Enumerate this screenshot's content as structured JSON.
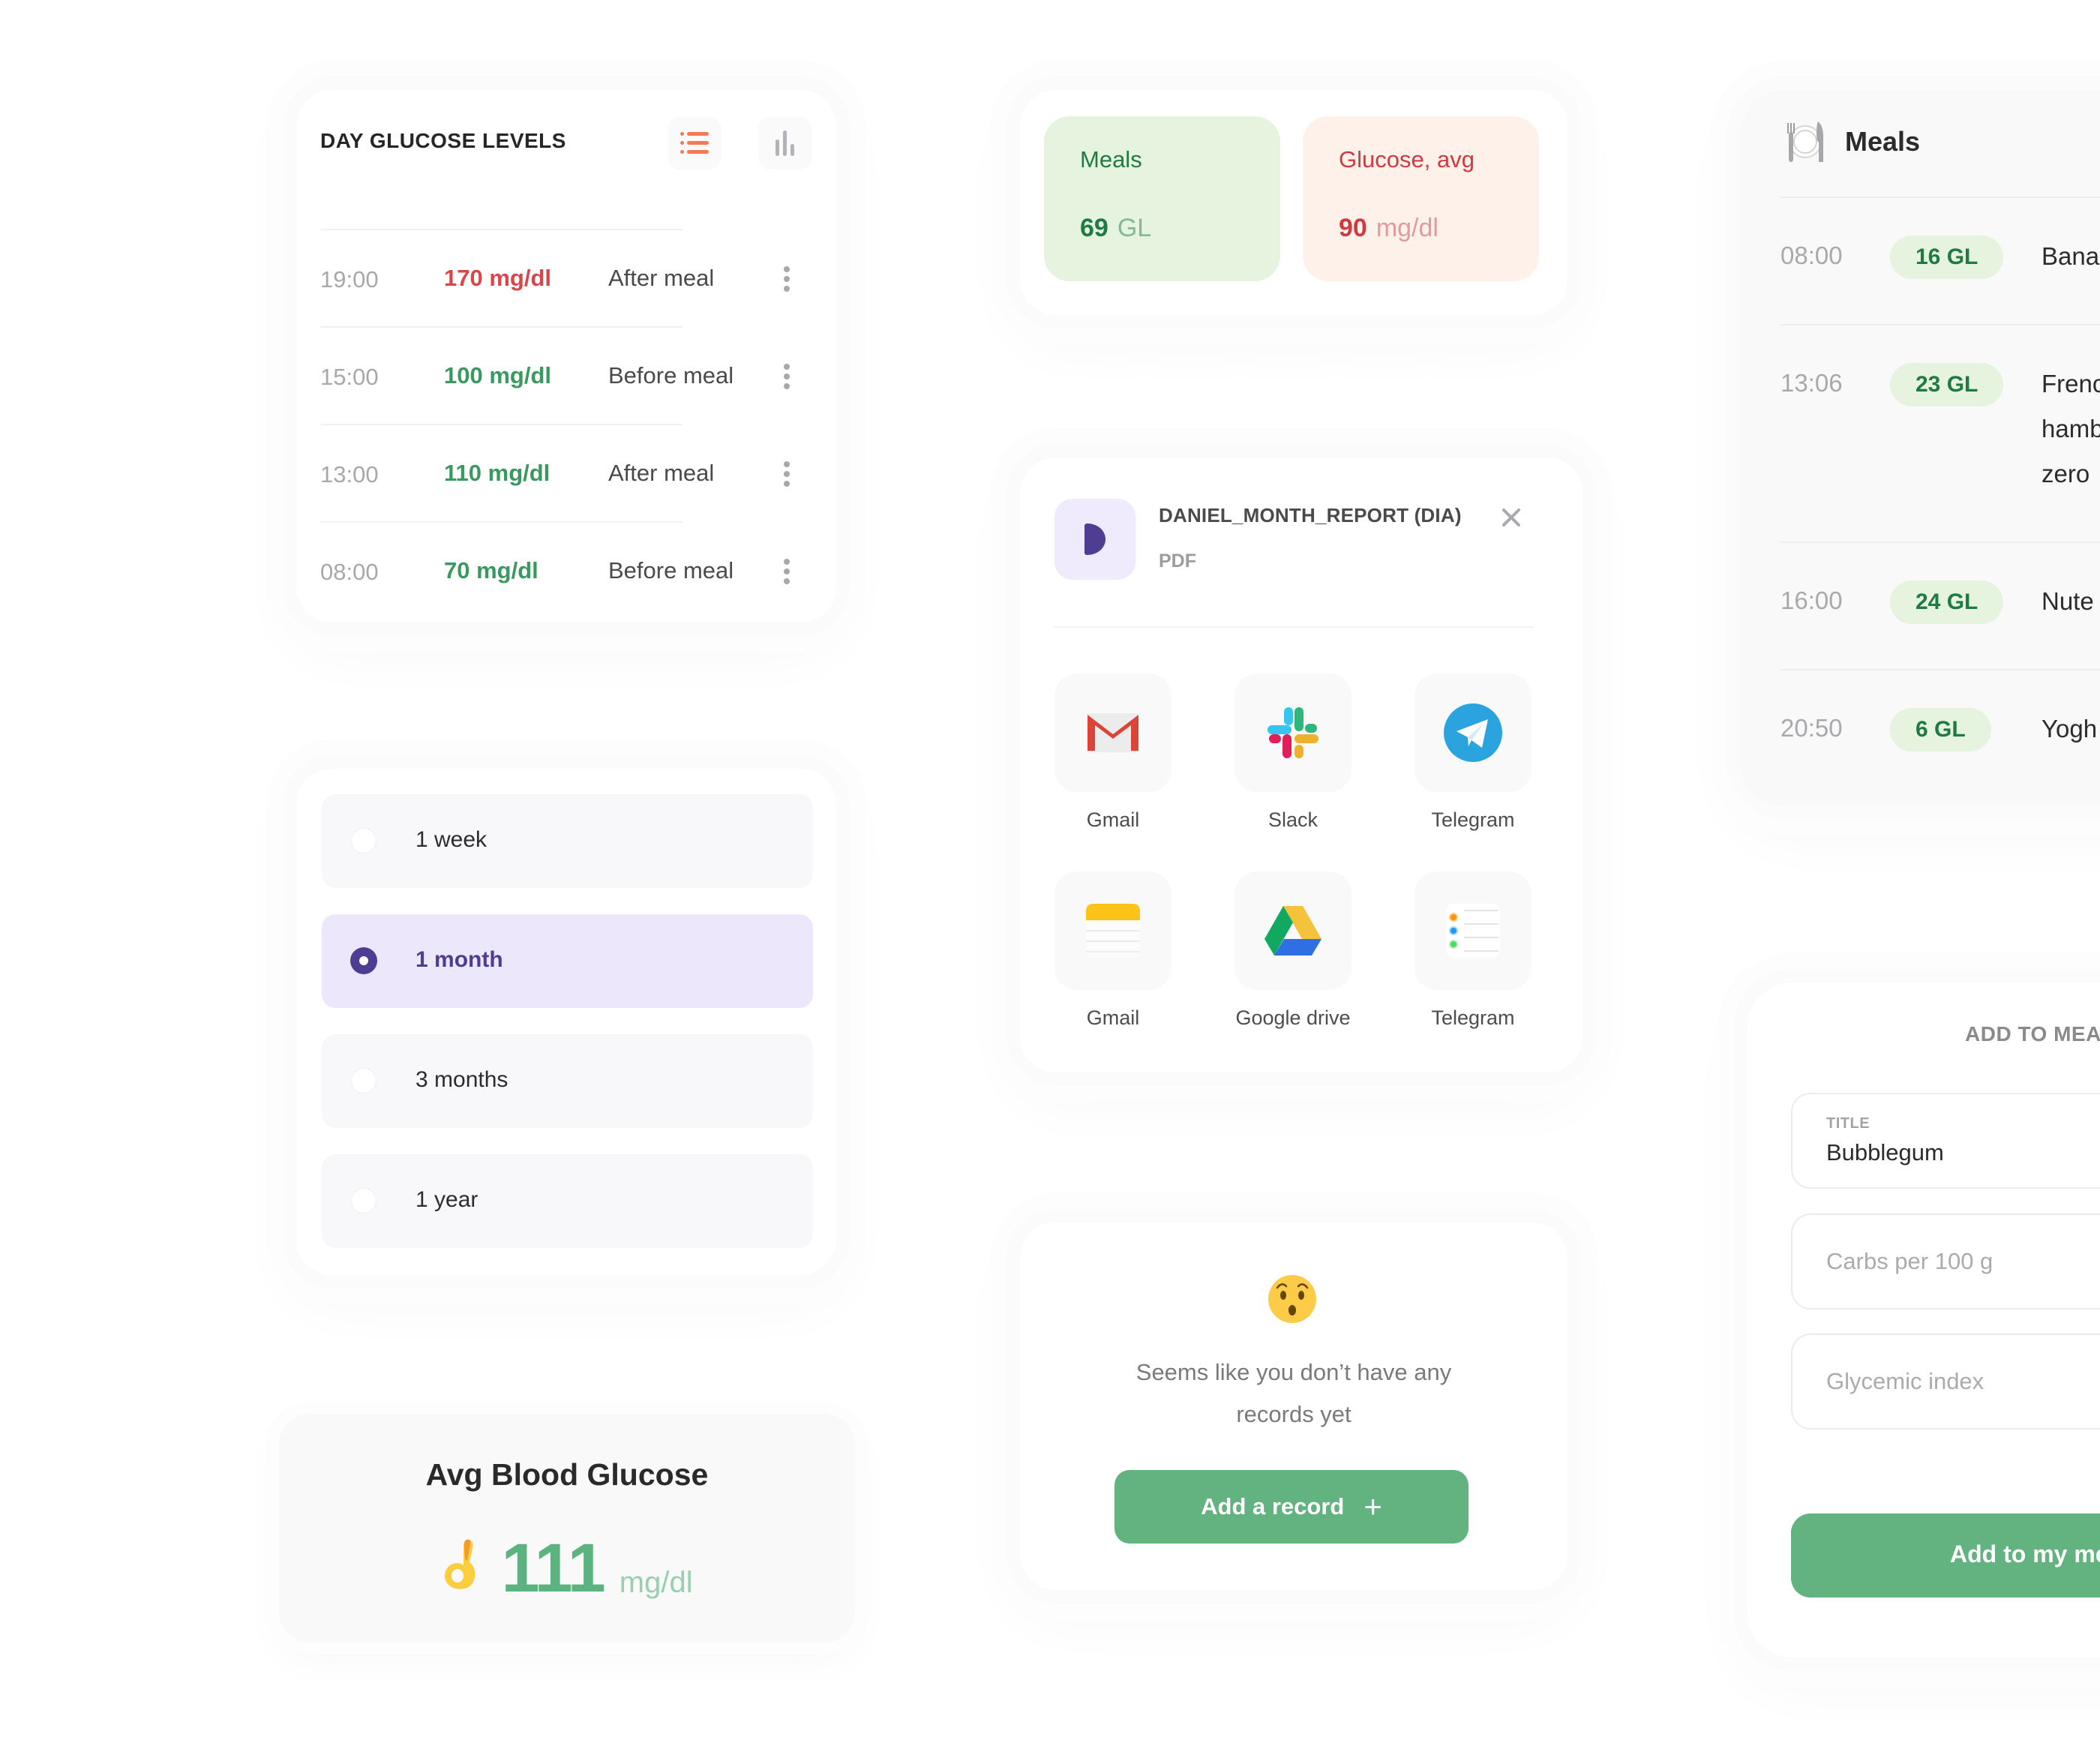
{
  "colors": {
    "accent_purple": "#4e3d92",
    "accent_green": "#63b381",
    "value_high": "#d9464a",
    "value_ok": "#3a9960",
    "list_view_active": "#f47a55"
  },
  "day_glucose": {
    "title": "DAY GLUCOSE LEVELS",
    "view_buttons": {
      "list": "list-view",
      "chart": "chart-view",
      "active": "list"
    },
    "rows": [
      {
        "time": "19:00",
        "value": "170 mg/dl",
        "status": "high",
        "note": "After meal"
      },
      {
        "time": "15:00",
        "value": "100 mg/dl",
        "status": "ok",
        "note": "Before meal"
      },
      {
        "time": "13:00",
        "value": "110 mg/dl",
        "status": "ok",
        "note": "After meal"
      },
      {
        "time": "08:00",
        "value": "70 mg/dl",
        "status": "ok",
        "note": "Before meal"
      }
    ]
  },
  "range_selector": {
    "selected": "1 month",
    "options": [
      {
        "label": "1 week",
        "selected": false
      },
      {
        "label": "1 month",
        "selected": true
      },
      {
        "label": "3 months",
        "selected": false
      },
      {
        "label": "1 year",
        "selected": false
      }
    ]
  },
  "avg_glucose": {
    "title": "Avg Blood Glucose",
    "value": "111",
    "unit": "mg/dl",
    "icon": "ok-hand-icon"
  },
  "summary": {
    "meals": {
      "label": "Meals",
      "value": "69",
      "unit": "GL"
    },
    "glucose": {
      "label": "Glucose, avg",
      "value": "90",
      "unit": "mg/dl"
    }
  },
  "share": {
    "file_letter": "D",
    "file_name": "DANIEL_MONTH_REPORT (DIA)",
    "file_type": "PDF",
    "apps": [
      {
        "name": "Gmail",
        "icon": "gmail-icon"
      },
      {
        "name": "Slack",
        "icon": "slack-icon"
      },
      {
        "name": "Telegram",
        "icon": "telegram-icon"
      },
      {
        "name": "Gmail",
        "icon": "notes-icon"
      },
      {
        "name": "Google drive",
        "icon": "google-drive-icon"
      },
      {
        "name": "Telegram",
        "icon": "reminders-icon"
      }
    ]
  },
  "empty_state": {
    "message": "Seems like you don’t have any records yet",
    "button_label": "Add a record",
    "button_icon": "+"
  },
  "meals": {
    "title": "Meals",
    "rows": [
      {
        "time": "08:00",
        "gl": "16 GL",
        "food_lines": [
          "Bana"
        ]
      },
      {
        "time": "13:06",
        "gl": "23 GL",
        "food_lines": [
          "Frenc",
          "hamb",
          "zero"
        ]
      },
      {
        "time": "16:00",
        "gl": "24 GL",
        "food_lines": [
          "Nute"
        ]
      },
      {
        "time": "20:50",
        "gl": "6 GL",
        "food_lines": [
          "Yogh"
        ]
      }
    ]
  },
  "add_meal": {
    "title": "ADD TO MEA",
    "title_field": {
      "label": "TITLE",
      "value": "Bubblegum"
    },
    "carbs_field": {
      "placeholder": "Carbs per 100 g"
    },
    "gi_field": {
      "placeholder": "Glycemic index"
    },
    "submit_label": "Add to my me"
  }
}
